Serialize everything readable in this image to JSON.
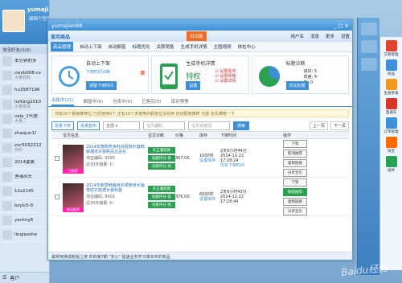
{
  "qq_panel": {
    "username": "yumajian88",
    "signature": "编辑个性签名",
    "group": "淘宝好友(0/0)",
    "friends": [
      {
        "name": "本分钟的多",
        "sub": ""
      },
      {
        "name": "cwxb008-cx",
        "sub": "大量收购"
      },
      {
        "name": "hu3587196",
        "sub": ""
      },
      {
        "name": "lurking2010",
        "sub": "大量供货"
      },
      {
        "name": "vala_1代理",
        "sub": "大量..."
      },
      {
        "name": "zhaojun1f",
        "sub": ""
      },
      {
        "name": "zxc5032212",
        "sub": "你好"
      },
      {
        "name": "2014夏装",
        "sub": ""
      },
      {
        "name": "渔港风头",
        "sub": ""
      },
      {
        "name": "11s2145",
        "sub": ""
      },
      {
        "name": "bzylc0-8",
        "sub": ""
      },
      {
        "name": "yaclmy6",
        "sub": ""
      },
      {
        "name": "linqiaoshe",
        "sub": ""
      }
    ],
    "bottom_label": "客户"
  },
  "window": {
    "title": "yumajian88",
    "app_title": "爱用商品",
    "qq_badge": "旧功能",
    "top_links": [
      "用户名",
      "消息",
      "更多",
      "设置"
    ],
    "toolbar": [
      {
        "label": "商品管理",
        "active": true
      },
      {
        "label": "自动上下架",
        "active": false
      },
      {
        "label": "自动橱窗",
        "active": false
      },
      {
        "label": "标题优化",
        "active": false
      },
      {
        "label": "关联销售",
        "active": false
      },
      {
        "label": "生成手机详情",
        "active": false
      },
      {
        "label": "主图视频",
        "active": false
      },
      {
        "label": "体检中心",
        "active": false
      }
    ],
    "cards": [
      {
        "title": "自动上下架",
        "sub": "下架时间诊断",
        "tag": "差",
        "button": "调整下架时间"
      },
      {
        "title": "生成手机详情",
        "feature": "特权",
        "checks": [
          "设置需求",
          "设置规格",
          "设置详情"
        ],
        "button": "设置"
      },
      {
        "title": "标题诊断",
        "stats": [
          "良好: 5",
          "较差: 4",
          "差: 0"
        ],
        "button": "优化标题"
      }
    ],
    "subtabs": [
      {
        "label": "出售中(21)",
        "active": true
      },
      {
        "label": "橱窗中(6)",
        "active": false
      },
      {
        "label": "仓库中(0)",
        "active": false
      },
      {
        "label": "已售完(0)",
        "active": false
      },
      {
        "label": "库存预警",
        "active": false
      }
    ],
    "notice": "你有20个橱窗推荐位,已经使用6个,还有16个未使用的橱窗位没效用 自动橱窗推荐 功能 抢先推荐一下",
    "filters": {
      "btn1": "批量下架",
      "btn2": "批量套用",
      "select": "全部",
      "input1_placeholder": "宝贝编码",
      "input2_placeholder": "宝贝关键词",
      "search": "搜索",
      "prev": "上一页",
      "next": "下一页"
    },
    "table": {
      "headers": [
        "",
        "宝贝信息",
        "宝贝诊断",
        "价格",
        "库存",
        "下架时间",
        "",
        "操作"
      ],
      "rows": [
        {
          "title": "2014年春款修身时尚短款外套韩版潮流女装新品正品女",
          "code": "淘宝编码: 9395",
          "sales": "近30天销量: 0",
          "tag": "已推荐",
          "diag": [
            "天王潮装款",
            "标题评分-优",
            "创意评分-优"
          ],
          "price": "367.00",
          "stock": "1500件",
          "stock_link": "设置库存",
          "time": "2天9小时44分",
          "time2": "2014-11-22",
          "time3": "17:28:24",
          "time_link": "优化下架时间",
          "actions": [
            "下架",
            "取消推荐",
            "复制链接",
            "分享宝贝"
          ]
        },
        {
          "title": "2014年新款韩版连衣裙修身长袖雪纺打底裙女装秋装",
          "code": "淘宝编码: 9401",
          "sales": "近30天销量: 0",
          "tag": "新品推荐",
          "diag": [
            "天王潮装款",
            "标题评分-优",
            "创意评分-优"
          ],
          "price": "376.00",
          "stock": "6000件",
          "stock_link": "设置库存",
          "time": "2天9小时43分",
          "time2": "2014-11-22",
          "time3": "17:28:44",
          "time_link": "",
          "actions": [
            "下架",
            "橱窗推荐",
            "复制链接",
            "分享宝贝"
          ]
        }
      ]
    },
    "status": "最常用换成新版上架   你的第7期 \"实心\" 提速业务学习课本中的商品"
  },
  "right_dock": [
    {
      "label": "交易管理",
      "color": "#e2432f"
    },
    {
      "label": "商品",
      "color": "#3e8fd6"
    },
    {
      "label": "生意参谋",
      "color": "#f09a23"
    },
    {
      "label": "直通车",
      "color": "#d9352a"
    },
    {
      "label": "订单管理",
      "color": "#3e8fd6"
    },
    {
      "label": "淘宝",
      "color": "#ff6a00"
    },
    {
      "label": "插件",
      "color": "#2aa150"
    }
  ],
  "watermark": "Baidu经验"
}
